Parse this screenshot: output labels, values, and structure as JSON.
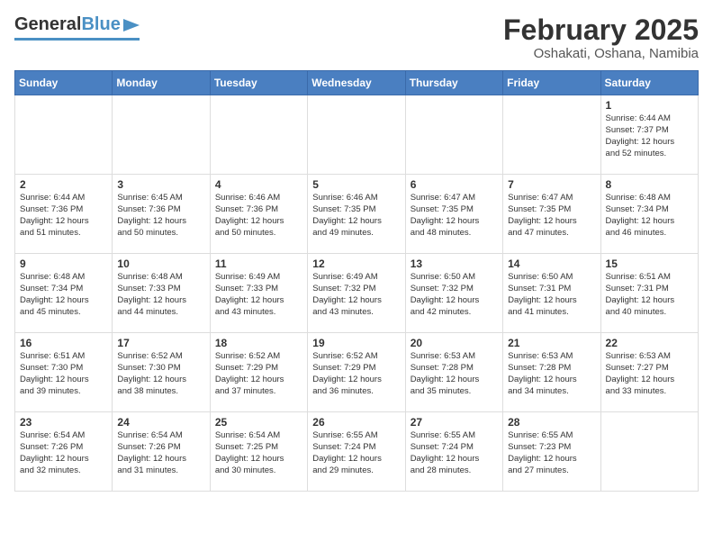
{
  "header": {
    "logo_general": "General",
    "logo_blue": "Blue",
    "title": "February 2025",
    "location": "Oshakati, Oshana, Namibia"
  },
  "calendar": {
    "days_of_week": [
      "Sunday",
      "Monday",
      "Tuesday",
      "Wednesday",
      "Thursday",
      "Friday",
      "Saturday"
    ],
    "weeks": [
      {
        "days": [
          {
            "num": "",
            "info": ""
          },
          {
            "num": "",
            "info": ""
          },
          {
            "num": "",
            "info": ""
          },
          {
            "num": "",
            "info": ""
          },
          {
            "num": "",
            "info": ""
          },
          {
            "num": "",
            "info": ""
          },
          {
            "num": "1",
            "info": "Sunrise: 6:44 AM\nSunset: 7:37 PM\nDaylight: 12 hours\nand 52 minutes."
          }
        ]
      },
      {
        "days": [
          {
            "num": "2",
            "info": "Sunrise: 6:44 AM\nSunset: 7:36 PM\nDaylight: 12 hours\nand 51 minutes."
          },
          {
            "num": "3",
            "info": "Sunrise: 6:45 AM\nSunset: 7:36 PM\nDaylight: 12 hours\nand 50 minutes."
          },
          {
            "num": "4",
            "info": "Sunrise: 6:46 AM\nSunset: 7:36 PM\nDaylight: 12 hours\nand 50 minutes."
          },
          {
            "num": "5",
            "info": "Sunrise: 6:46 AM\nSunset: 7:35 PM\nDaylight: 12 hours\nand 49 minutes."
          },
          {
            "num": "6",
            "info": "Sunrise: 6:47 AM\nSunset: 7:35 PM\nDaylight: 12 hours\nand 48 minutes."
          },
          {
            "num": "7",
            "info": "Sunrise: 6:47 AM\nSunset: 7:35 PM\nDaylight: 12 hours\nand 47 minutes."
          },
          {
            "num": "8",
            "info": "Sunrise: 6:48 AM\nSunset: 7:34 PM\nDaylight: 12 hours\nand 46 minutes."
          }
        ]
      },
      {
        "days": [
          {
            "num": "9",
            "info": "Sunrise: 6:48 AM\nSunset: 7:34 PM\nDaylight: 12 hours\nand 45 minutes."
          },
          {
            "num": "10",
            "info": "Sunrise: 6:48 AM\nSunset: 7:33 PM\nDaylight: 12 hours\nand 44 minutes."
          },
          {
            "num": "11",
            "info": "Sunrise: 6:49 AM\nSunset: 7:33 PM\nDaylight: 12 hours\nand 43 minutes."
          },
          {
            "num": "12",
            "info": "Sunrise: 6:49 AM\nSunset: 7:32 PM\nDaylight: 12 hours\nand 43 minutes."
          },
          {
            "num": "13",
            "info": "Sunrise: 6:50 AM\nSunset: 7:32 PM\nDaylight: 12 hours\nand 42 minutes."
          },
          {
            "num": "14",
            "info": "Sunrise: 6:50 AM\nSunset: 7:31 PM\nDaylight: 12 hours\nand 41 minutes."
          },
          {
            "num": "15",
            "info": "Sunrise: 6:51 AM\nSunset: 7:31 PM\nDaylight: 12 hours\nand 40 minutes."
          }
        ]
      },
      {
        "days": [
          {
            "num": "16",
            "info": "Sunrise: 6:51 AM\nSunset: 7:30 PM\nDaylight: 12 hours\nand 39 minutes."
          },
          {
            "num": "17",
            "info": "Sunrise: 6:52 AM\nSunset: 7:30 PM\nDaylight: 12 hours\nand 38 minutes."
          },
          {
            "num": "18",
            "info": "Sunrise: 6:52 AM\nSunset: 7:29 PM\nDaylight: 12 hours\nand 37 minutes."
          },
          {
            "num": "19",
            "info": "Sunrise: 6:52 AM\nSunset: 7:29 PM\nDaylight: 12 hours\nand 36 minutes."
          },
          {
            "num": "20",
            "info": "Sunrise: 6:53 AM\nSunset: 7:28 PM\nDaylight: 12 hours\nand 35 minutes."
          },
          {
            "num": "21",
            "info": "Sunrise: 6:53 AM\nSunset: 7:28 PM\nDaylight: 12 hours\nand 34 minutes."
          },
          {
            "num": "22",
            "info": "Sunrise: 6:53 AM\nSunset: 7:27 PM\nDaylight: 12 hours\nand 33 minutes."
          }
        ]
      },
      {
        "days": [
          {
            "num": "23",
            "info": "Sunrise: 6:54 AM\nSunset: 7:26 PM\nDaylight: 12 hours\nand 32 minutes."
          },
          {
            "num": "24",
            "info": "Sunrise: 6:54 AM\nSunset: 7:26 PM\nDaylight: 12 hours\nand 31 minutes."
          },
          {
            "num": "25",
            "info": "Sunrise: 6:54 AM\nSunset: 7:25 PM\nDaylight: 12 hours\nand 30 minutes."
          },
          {
            "num": "26",
            "info": "Sunrise: 6:55 AM\nSunset: 7:24 PM\nDaylight: 12 hours\nand 29 minutes."
          },
          {
            "num": "27",
            "info": "Sunrise: 6:55 AM\nSunset: 7:24 PM\nDaylight: 12 hours\nand 28 minutes."
          },
          {
            "num": "28",
            "info": "Sunrise: 6:55 AM\nSunset: 7:23 PM\nDaylight: 12 hours\nand 27 minutes."
          },
          {
            "num": "",
            "info": ""
          }
        ]
      }
    ]
  }
}
